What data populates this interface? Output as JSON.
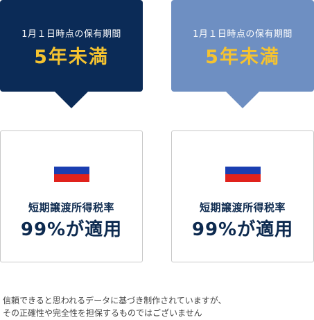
{
  "columns": [
    {
      "bubble": {
        "label": "1月１日時点の保有期間",
        "value": "5年未満",
        "bg_color": "#0b2b57",
        "value_color": "#f5c330"
      },
      "card": {
        "flag_icon": "russia-flag-icon",
        "flag_colors": [
          "#ffffff",
          "#1a3eb1",
          "#e0221c"
        ],
        "label": "短期譲渡所得税率",
        "value": "99%が適用"
      }
    },
    {
      "bubble": {
        "label": "1月１日時点の保有期間",
        "value": "5年未満",
        "bg_color": "#6e8fc2",
        "value_color": "#f5c330"
      },
      "card": {
        "flag_icon": "russia-flag-icon",
        "flag_colors": [
          "#ffffff",
          "#1a3eb1",
          "#e0221c"
        ],
        "label": "短期譲渡所得税率",
        "value": "99%が適用"
      }
    }
  ],
  "disclaimer": {
    "line1": "信頼できると思われるデータに基づき制作されていますが、",
    "line2": "その正確性や完全性を担保するものではございません"
  }
}
